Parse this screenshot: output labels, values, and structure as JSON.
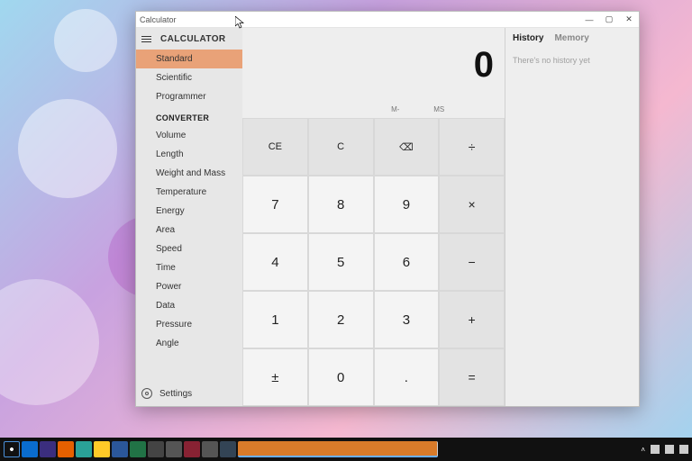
{
  "window": {
    "title": "Calculator"
  },
  "nav": {
    "header": "CALCULATOR",
    "calculator_items": [
      "Standard",
      "Scientific",
      "Programmer"
    ],
    "converter_label": "CONVERTER",
    "converter_items": [
      "Volume",
      "Length",
      "Weight and Mass",
      "Temperature",
      "Energy",
      "Area",
      "Speed",
      "Time",
      "Power",
      "Data",
      "Pressure",
      "Angle"
    ],
    "settings": "Settings"
  },
  "display": {
    "value": "0"
  },
  "memory_buttons": [
    "",
    "",
    "",
    "M-",
    "MS",
    ""
  ],
  "keys": {
    "r0": [
      "CE",
      "C",
      "⌫",
      "÷"
    ],
    "r1": [
      "7",
      "8",
      "9",
      "×"
    ],
    "r2": [
      "4",
      "5",
      "6",
      "−"
    ],
    "r3": [
      "1",
      "2",
      "3",
      "+"
    ],
    "r4": [
      "±",
      "0",
      ".",
      "="
    ]
  },
  "history": {
    "tabs": [
      "History",
      "Memory"
    ],
    "empty": "There's no history yet"
  }
}
